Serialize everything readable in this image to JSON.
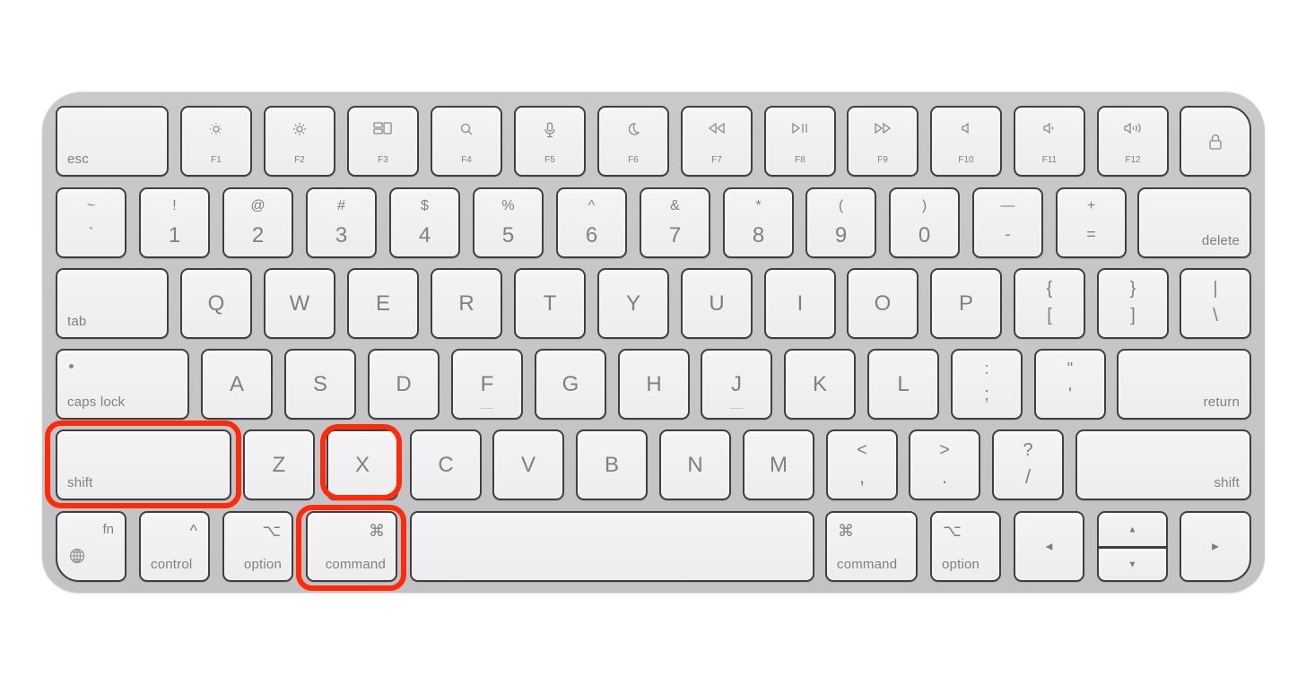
{
  "image": {
    "subject": "Apple Magic Keyboard",
    "highlight_color": "#ff2a0a",
    "highlighted_keys": [
      "shift",
      "X",
      "command"
    ]
  },
  "keys": {
    "row1": {
      "esc": "esc",
      "f": [
        {
          "label": "F1",
          "icon": "brightness-down-icon"
        },
        {
          "label": "F2",
          "icon": "brightness-up-icon"
        },
        {
          "label": "F3",
          "icon": "mission-control-icon"
        },
        {
          "label": "F4",
          "icon": "search-icon"
        },
        {
          "label": "F5",
          "icon": "microphone-icon"
        },
        {
          "label": "F6",
          "icon": "moon-icon"
        },
        {
          "label": "F7",
          "icon": "rewind-icon"
        },
        {
          "label": "F8",
          "icon": "play-pause-icon"
        },
        {
          "label": "F9",
          "icon": "fast-forward-icon"
        },
        {
          "label": "F10",
          "icon": "mute-icon"
        },
        {
          "label": "F11",
          "icon": "volume-down-icon"
        },
        {
          "label": "F12",
          "icon": "volume-up-icon"
        }
      ],
      "lock_icon": "lock-icon"
    },
    "row2": {
      "keys": [
        {
          "top": "~",
          "bottom": "`"
        },
        {
          "top": "!",
          "bottom": "1"
        },
        {
          "top": "@",
          "bottom": "2"
        },
        {
          "top": "#",
          "bottom": "3"
        },
        {
          "top": "$",
          "bottom": "4"
        },
        {
          "top": "%",
          "bottom": "5"
        },
        {
          "top": "^",
          "bottom": "6"
        },
        {
          "top": "&",
          "bottom": "7"
        },
        {
          "top": "*",
          "bottom": "8"
        },
        {
          "top": "(",
          "bottom": "9"
        },
        {
          "top": ")",
          "bottom": "0"
        },
        {
          "top": "—",
          "bottom": "-"
        },
        {
          "top": "+",
          "bottom": "="
        }
      ],
      "delete": "delete"
    },
    "row3": {
      "tab": "tab",
      "letters": [
        "Q",
        "W",
        "E",
        "R",
        "T",
        "Y",
        "U",
        "I",
        "O",
        "P"
      ],
      "brackets": [
        {
          "top": "{",
          "bottom": "["
        },
        {
          "top": "}",
          "bottom": "]"
        },
        {
          "top": "|",
          "bottom": "\\"
        }
      ]
    },
    "row4": {
      "caps_lock": "caps lock",
      "letters": [
        "A",
        "S",
        "D",
        "F",
        "G",
        "H",
        "J",
        "K",
        "L"
      ],
      "punct": [
        {
          "top": ":",
          "bottom": ";"
        },
        {
          "top": "\"",
          "bottom": "'"
        }
      ],
      "return": "return"
    },
    "row5": {
      "shift_left": "shift",
      "letters": [
        "Z",
        "X",
        "C",
        "V",
        "B",
        "N",
        "M"
      ],
      "punct": [
        {
          "top": "<",
          "bottom": ","
        },
        {
          "top": ">",
          "bottom": "."
        },
        {
          "top": "?",
          "bottom": "/"
        }
      ],
      "shift_right": "shift"
    },
    "row6": {
      "fn": "fn",
      "control": "control",
      "control_sym": "^",
      "option_left": "option",
      "option_sym": "⌥",
      "command_left": "command",
      "command_sym": "⌘",
      "command_right": "command",
      "option_right": "option",
      "arrow_left": "◀",
      "arrow_up": "▲",
      "arrow_down": "▼",
      "arrow_right": "▶"
    }
  }
}
